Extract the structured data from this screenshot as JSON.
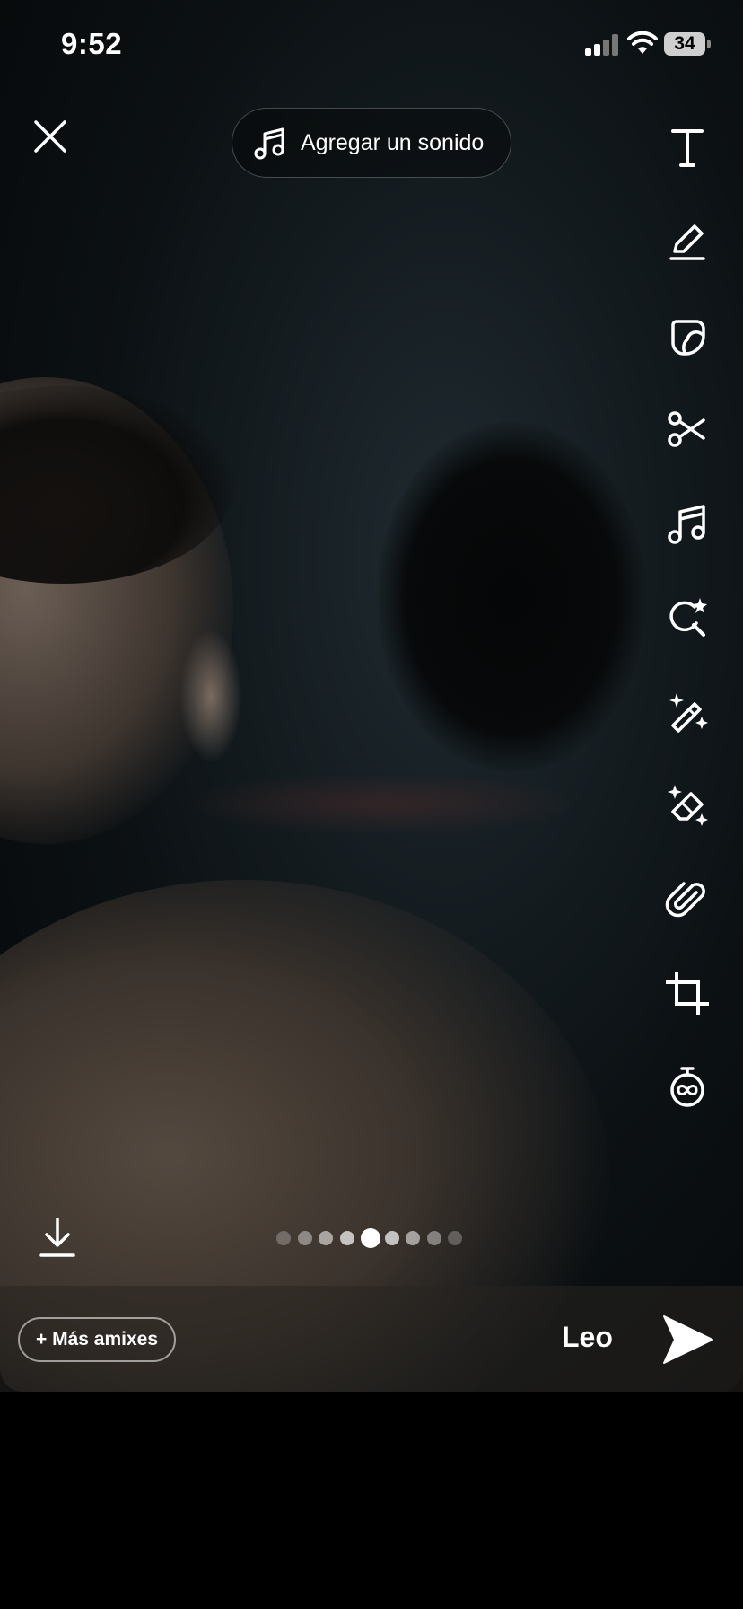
{
  "status_bar": {
    "time": "9:52",
    "battery": "34"
  },
  "top": {
    "sound_button_label": "Agregar un sonido"
  },
  "toolbar": {
    "items": [
      "text-icon",
      "pencil-icon",
      "sticker-icon",
      "scissors-icon",
      "music-icon",
      "lens-search-icon",
      "magic-wand-icon",
      "eraser-icon",
      "paperclip-icon",
      "crop-icon",
      "timer-icon"
    ]
  },
  "pager": {
    "count": 9,
    "active_index": 4
  },
  "bottom": {
    "amixes_label": "+ Más amixes",
    "recipient": "Leo"
  }
}
